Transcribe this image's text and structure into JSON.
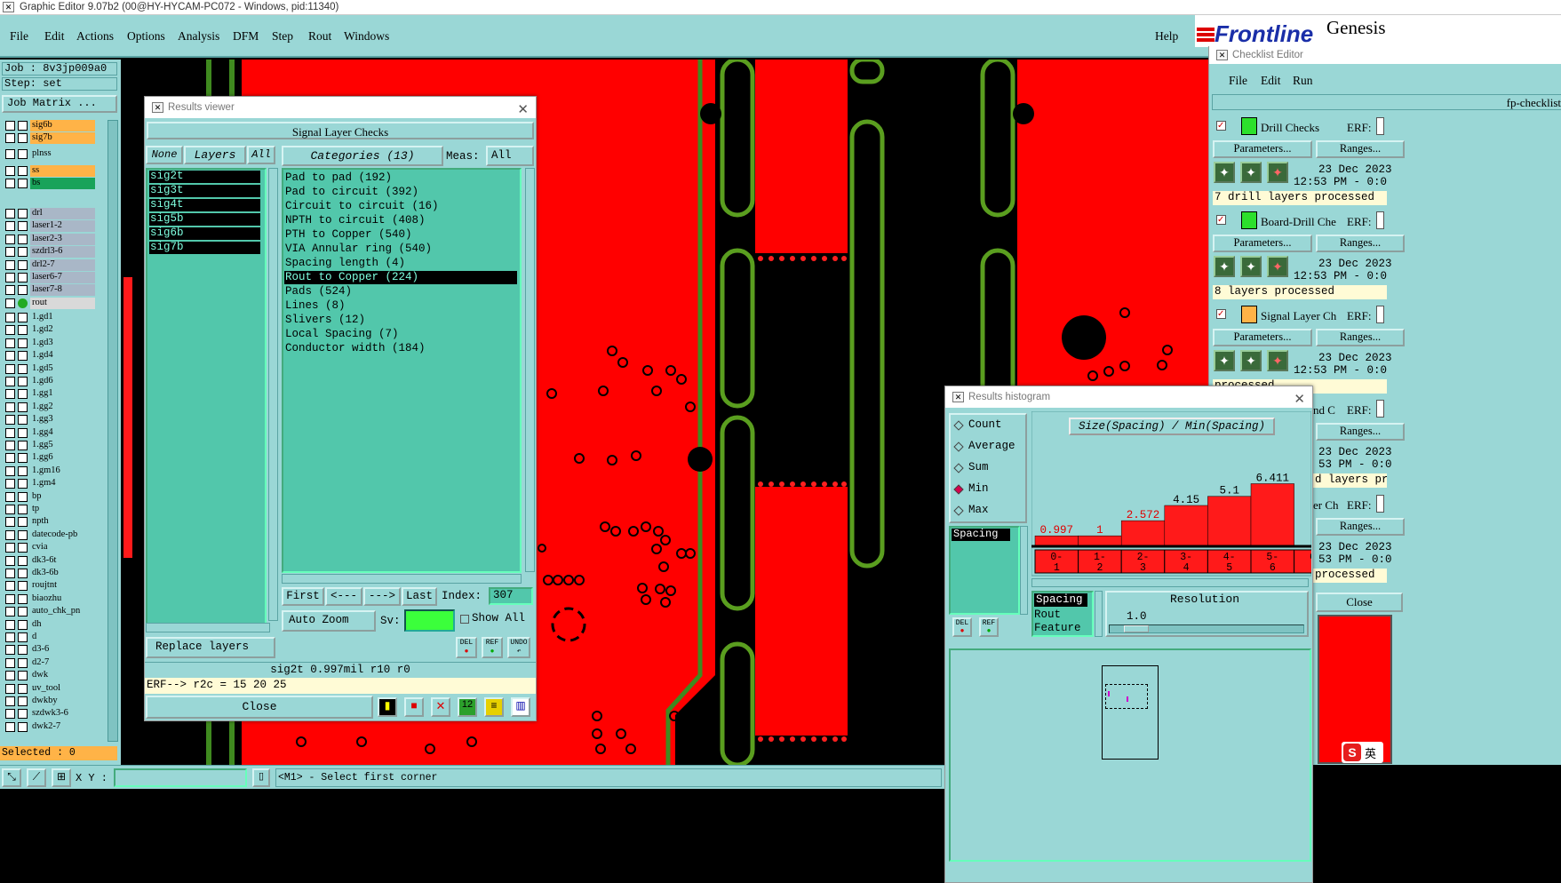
{
  "window": {
    "title": "Graphic Editor 9.07b2 (00@HY-HYCAM-PC072 - Windows, pid:11340)"
  },
  "menu": [
    "File",
    "Edit",
    "Actions",
    "Options",
    "Analysis",
    "DFM",
    "Step",
    "Rout",
    "Windows"
  ],
  "help": "Help",
  "brand": {
    "logo": "Frontline",
    "product": "Genesis"
  },
  "job": {
    "label": "Job : 8v3jp009a0",
    "step": "Step: set",
    "matrix_button": "Job Matrix ..."
  },
  "layers": [
    {
      "name": "sig6b",
      "bg": "#ffb347"
    },
    {
      "name": "sig7b",
      "bg": "#ffb347"
    },
    {
      "name": "plnss",
      "bg": "#9ad7d6"
    },
    {
      "name": "ss",
      "bg": "#ffb347"
    },
    {
      "name": "bs",
      "bg": "#19a35a"
    },
    {
      "name": "bo",
      "bg": "#ffffff"
    },
    {
      "name": "drl",
      "bg": "#a9b7c7"
    },
    {
      "name": "laser1-2",
      "bg": "#a9b7c7"
    },
    {
      "name": "laser2-3",
      "bg": "#a9b7c7"
    },
    {
      "name": "szdrl3-6",
      "bg": "#a9b7c7"
    },
    {
      "name": "drl2-7",
      "bg": "#a9b7c7"
    },
    {
      "name": "laser6-7",
      "bg": "#a9b7c7"
    },
    {
      "name": "laser7-8",
      "bg": "#a9b7c7"
    },
    {
      "name": "rout",
      "bg": "#d9d9d9"
    },
    {
      "name": "1.gd1",
      "bg": "#9ad7d6"
    },
    {
      "name": "1.gd2",
      "bg": "#9ad7d6"
    },
    {
      "name": "1.gd3",
      "bg": "#9ad7d6"
    },
    {
      "name": "1.gd4",
      "bg": "#9ad7d6"
    },
    {
      "name": "1.gd5",
      "bg": "#9ad7d6"
    },
    {
      "name": "1.gd6",
      "bg": "#9ad7d6"
    },
    {
      "name": "1.gg1",
      "bg": "#9ad7d6"
    },
    {
      "name": "1.gg2",
      "bg": "#9ad7d6"
    },
    {
      "name": "1.gg3",
      "bg": "#9ad7d6"
    },
    {
      "name": "1.gg4",
      "bg": "#9ad7d6"
    },
    {
      "name": "1.gg5",
      "bg": "#9ad7d6"
    },
    {
      "name": "1.gg6",
      "bg": "#9ad7d6"
    },
    {
      "name": "1.gm16",
      "bg": "#9ad7d6"
    },
    {
      "name": "1.gm4",
      "bg": "#9ad7d6"
    },
    {
      "name": "bp",
      "bg": "#9ad7d6"
    },
    {
      "name": "tp",
      "bg": "#9ad7d6"
    },
    {
      "name": "npth",
      "bg": "#9ad7d6"
    },
    {
      "name": "datecode-pb",
      "bg": "#9ad7d6"
    },
    {
      "name": "cvia",
      "bg": "#9ad7d6"
    },
    {
      "name": "dk3-6t",
      "bg": "#9ad7d6"
    },
    {
      "name": "dk3-6b",
      "bg": "#9ad7d6"
    },
    {
      "name": "roujtnt",
      "bg": "#9ad7d6"
    },
    {
      "name": "biaozhu",
      "bg": "#9ad7d6"
    },
    {
      "name": "auto_chk_pn",
      "bg": "#9ad7d6"
    },
    {
      "name": "dh",
      "bg": "#9ad7d6"
    },
    {
      "name": "d",
      "bg": "#9ad7d6"
    },
    {
      "name": "d3-6",
      "bg": "#9ad7d6"
    },
    {
      "name": "d2-7",
      "bg": "#9ad7d6"
    },
    {
      "name": "dwk",
      "bg": "#9ad7d6"
    },
    {
      "name": "uv_tool",
      "bg": "#9ad7d6"
    },
    {
      "name": "dwkby",
      "bg": "#9ad7d6"
    },
    {
      "name": "szdwk3-6",
      "bg": "#9ad7d6"
    },
    {
      "name": "dwk2-7",
      "bg": "#9ad7d6"
    }
  ],
  "selected": "Selected : 0",
  "results_viewer": {
    "title": "Results viewer",
    "header": "Signal Layer Checks",
    "none": "None",
    "layers": "Layers",
    "all": "All",
    "categories_label": "Categories (13)",
    "meas": "Meas:",
    "meas_value": "All",
    "layer_list": [
      "sig2t",
      "sig3t",
      "sig4t",
      "sig5b",
      "sig6b",
      "sig7b"
    ],
    "categories": [
      "Pad to pad (192)",
      "Pad to circuit (392)",
      "Circuit to circuit (16)",
      "NPTH to circuit (408)",
      "PTH to Copper (540)",
      "VIA Annular ring (540)",
      "Spacing length (4)",
      "Rout to Copper (224)",
      "Pads (524)",
      "Lines (8)",
      "Slivers (12)",
      "Local Spacing (7)",
      "Conductor width (184)"
    ],
    "selected_category": 7,
    "nav": {
      "first": "First",
      "prev": "<---",
      "next": "--->",
      "last": "Last",
      "index_label": "Index:",
      "index_value": "307"
    },
    "auto_zoom": "Auto Zoom",
    "sv": "Sv:",
    "show_all": "Show All",
    "replace_layers": "Replace layers",
    "del": "DEL",
    "ref": "REF",
    "undo": "UNDO",
    "status": "sig2t 0.997mil  r10  r0",
    "erf": "ERF--> r2c = 15 20 25",
    "close": "Close"
  },
  "checklist": {
    "title": "Checklist Editor",
    "menu": [
      "File",
      "Edit",
      "Run"
    ],
    "name": "fp-checklist",
    "items": [
      {
        "label": "Drill Checks",
        "erf": "ERF:",
        "params": "Parameters...",
        "ranges": "Ranges...",
        "date": "23 Dec 2023",
        "time": "12:53 PM - 0:0",
        "status": "7 drill layers processed"
      },
      {
        "label": "Board-Drill Che",
        "erf": "ERF:",
        "params": "Parameters...",
        "ranges": "Ranges...",
        "date": "23 Dec 2023",
        "time": "12:53 PM - 0:0",
        "status": "8 layers processed"
      },
      {
        "label": "Signal Layer Ch",
        "erf": "ERF:",
        "params": "Parameters...",
        "ranges": "Ranges...",
        "date": "23 Dec 2023",
        "time": "12:53 PM - 0:0",
        "status": "processed"
      },
      {
        "label": "nd C",
        "erf": "ERF:",
        "params": "",
        "ranges": "Ranges...",
        "date": "23 Dec 2023",
        "time": "53 PM - 0:0",
        "status": "d layers pro"
      },
      {
        "label": "er Ch",
        "erf": "ERF:",
        "params": "",
        "ranges": "Ranges...",
        "date": "23 Dec 2023",
        "time": "53 PM - 0:0",
        "status": "processed"
      }
    ],
    "close": "Close"
  },
  "histogram": {
    "title": "Results histogram",
    "modes": [
      "Count",
      "Average",
      "Sum",
      "Min",
      "Max"
    ],
    "selected_mode": 3,
    "chart_title": "Size(Spacing) / Min(Spacing)",
    "list": [
      "Spacing"
    ],
    "res_list": [
      "Spacing",
      "Rout",
      "Feature"
    ],
    "resolution_label": "Resolution",
    "resolution_value": "1.0",
    "del": "DEL",
    "ref": "REF"
  },
  "chart_data": {
    "type": "bar",
    "title": "Size(Spacing) / Min(Spacing)",
    "categories": [
      "0-1",
      "1-2",
      "2-3",
      "3-4",
      "4-5",
      "5-6",
      "6-7"
    ],
    "category_labels": [
      [
        "0-",
        "1"
      ],
      [
        "1-",
        "2"
      ],
      [
        "2-",
        "3"
      ],
      [
        "3-",
        "4"
      ],
      [
        "4-",
        "5"
      ],
      [
        "5-",
        "6"
      ],
      [
        "6-",
        "7"
      ]
    ],
    "values": [
      0.997,
      1,
      2.572,
      4.15,
      5.1,
      6.411
    ],
    "value_labels": [
      "0.997",
      "1",
      "2.572",
      "4.15",
      "5.1",
      "6.411"
    ],
    "ylim": [
      0,
      7
    ],
    "bar_color": "#ff1a1a"
  },
  "bottom": {
    "xy_label": "X Y :",
    "prompt": "<M1> - Select first corner",
    "ime": "英"
  }
}
